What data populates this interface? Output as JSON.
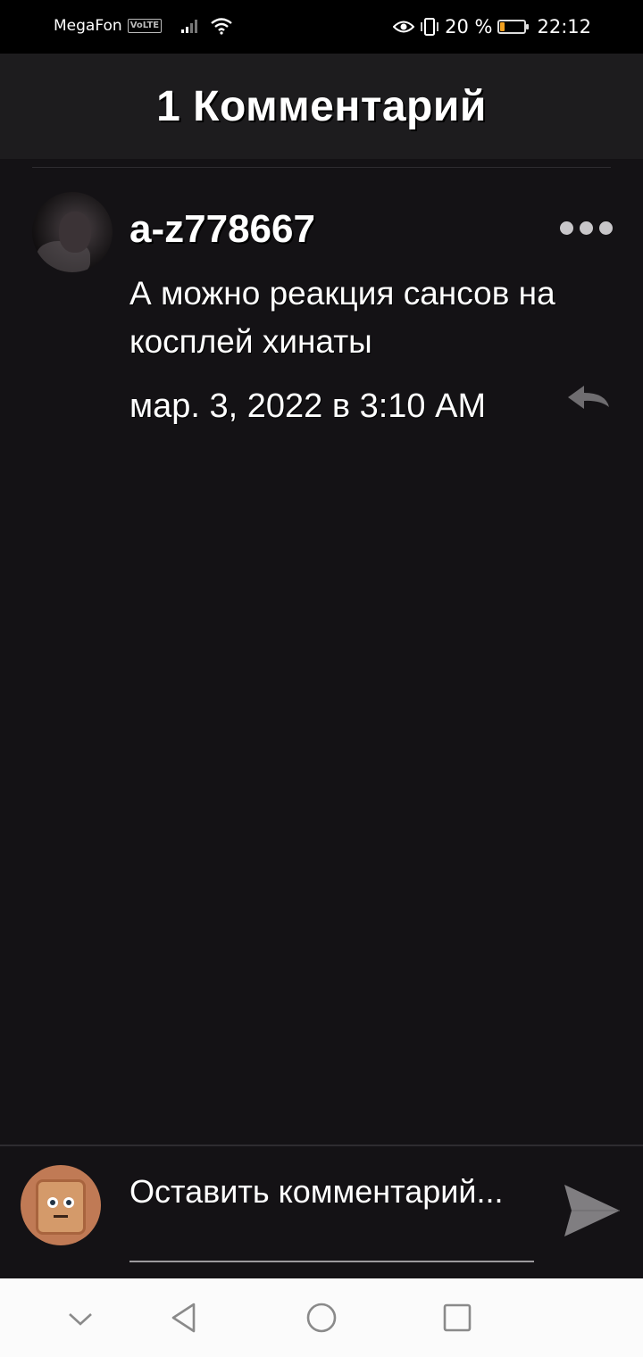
{
  "status_bar": {
    "carrier": "MegaFon",
    "volte": "VoLTE",
    "battery_text": "20 %",
    "battery_level": 0.2,
    "time": "22:12",
    "icons": [
      "signal-icon",
      "wifi-icon",
      "eye-comfort-icon",
      "vibrate-icon",
      "battery-icon"
    ]
  },
  "header": {
    "title": "1 Комментарий"
  },
  "comments": [
    {
      "username": "a-z778667",
      "text": "А можно реакция сансов на косплей хинаты",
      "time": "мар. 3, 2022 в 3:10 AM"
    }
  ],
  "composer": {
    "placeholder": "Оставить комментарий..."
  },
  "colors": {
    "background": "#141215",
    "header": "#1d1c1e",
    "battery_accent": "#f0a020"
  }
}
